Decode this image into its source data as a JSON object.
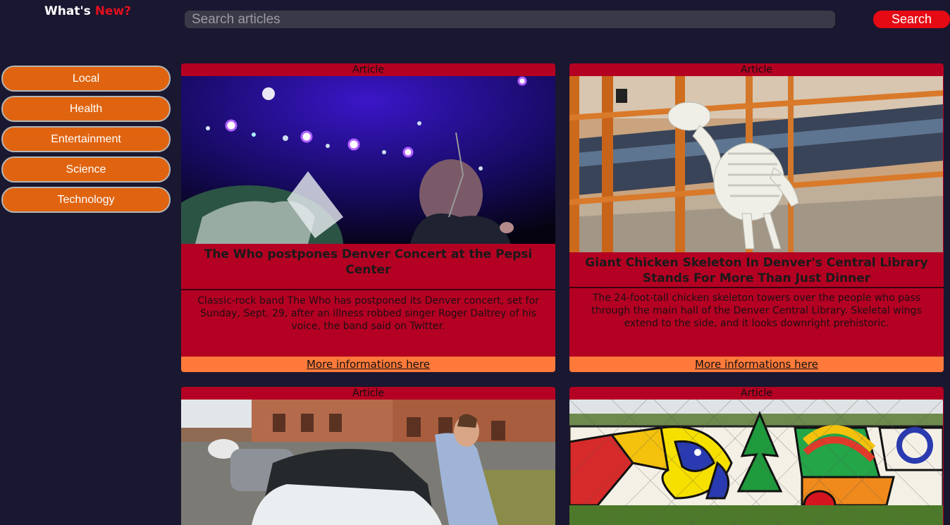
{
  "header": {
    "logo_part1": "What's",
    "logo_part2": "New?",
    "search_placeholder": "Search articles",
    "search_button": "Search"
  },
  "sidebar": {
    "items": [
      {
        "label": "Local"
      },
      {
        "label": "Health"
      },
      {
        "label": "Entertainment"
      },
      {
        "label": "Science"
      },
      {
        "label": "Technology"
      }
    ]
  },
  "articles": [
    {
      "label": "Article",
      "title": "The Who postpones Denver Concert at the Pepsi Center",
      "description": "Classic-rock band The Who has postponed its Denver concert, set for Sunday, Sept. 29, after an illness robbed singer Roger Daltrey of his voice, the band said on Twitter.",
      "link": "More informations here"
    },
    {
      "label": "Article",
      "title": "Giant Chicken Skeleton In Denver's Central Library Stands For More Than Just Dinner",
      "description": "The 24-foot-tall chicken skeleton towers over the people who pass through the main hall of the Denver Central Library. Skeletal wings extend to the side, and it looks downright prehistoric.",
      "link": "More informations here"
    },
    {
      "label": "Article"
    },
    {
      "label": "Article"
    }
  ],
  "colors": {
    "background": "#1a1730",
    "card": "#b40022",
    "link_bar": "#ff7a3a",
    "sidebar_button": "#e06410",
    "search_button": "#e50a14",
    "logo_accent": "#e0101e"
  }
}
